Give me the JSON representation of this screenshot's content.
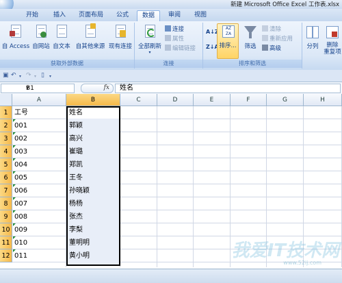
{
  "window": {
    "title": "新建 Microsoft Office Excel 工作表.xlsx"
  },
  "tabs": [
    {
      "label": "开始",
      "active": false
    },
    {
      "label": "插入",
      "active": false
    },
    {
      "label": "页面布局",
      "active": false
    },
    {
      "label": "公式",
      "active": false
    },
    {
      "label": "数据",
      "active": true
    },
    {
      "label": "审阅",
      "active": false
    },
    {
      "label": "视图",
      "active": false
    }
  ],
  "ribbon": {
    "get_external": {
      "label": "获取外部数据",
      "buttons": [
        "自 Access",
        "自网站",
        "自文本",
        "自其他来源",
        "现有连接"
      ]
    },
    "connections": {
      "label": "连接",
      "refresh": "全部刷新",
      "small": [
        "连接",
        "属性",
        "编辑链接"
      ]
    },
    "sort_filter": {
      "label": "排序和筛选",
      "sort": "排序...",
      "filter": "筛选",
      "small": [
        "清除",
        "重新应用",
        "高级"
      ]
    },
    "tools": {
      "split": "分列",
      "remove": "删除",
      "remove2": "重复项"
    }
  },
  "formula_bar": {
    "name_box": "B1",
    "fx": "fx",
    "value": "姓名"
  },
  "columns": [
    "A",
    "B",
    "C",
    "D",
    "E",
    "F",
    "G",
    "H"
  ],
  "rows": [
    "1",
    "2",
    "3",
    "4",
    "5",
    "6",
    "7",
    "8",
    "9",
    "10",
    "11",
    "12"
  ],
  "cells": {
    "col_a": [
      "工号",
      "001",
      "002",
      "003",
      "004",
      "005",
      "006",
      "007",
      "008",
      "009",
      "010",
      "011"
    ],
    "col_b": [
      "姓名",
      "郭颖",
      "高兴",
      "崔璐",
      "郑凯",
      "王冬",
      "孙晓颖",
      "杨杨",
      "张杰",
      "李梨",
      "董明明",
      "黄小明"
    ]
  },
  "watermark": {
    "text": "我爱IT技术网",
    "url": "www.52ij.com"
  },
  "colors": {
    "selected_header": "#f6b94a",
    "ribbon": "#dce8f7",
    "accent": "#15428b"
  }
}
